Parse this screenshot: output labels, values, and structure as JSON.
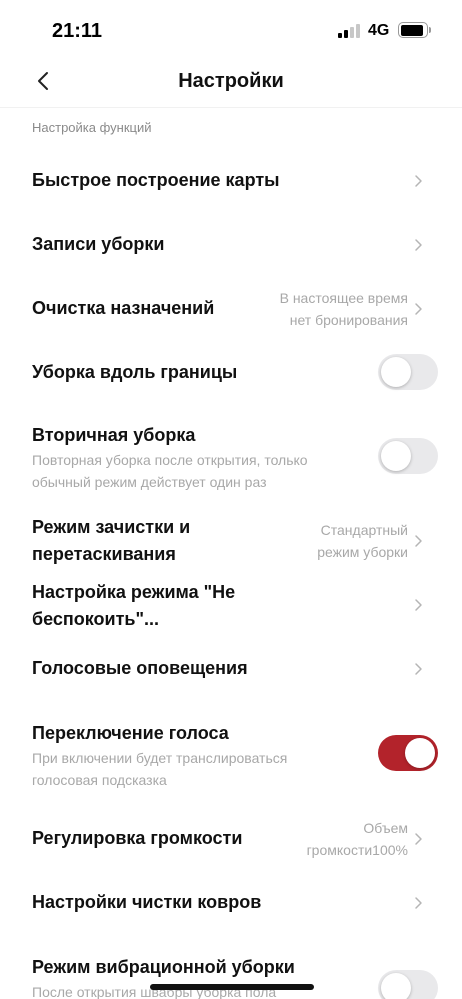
{
  "status_bar": {
    "time": "21:11",
    "network": "4G",
    "battery_level": 0.9
  },
  "header": {
    "title": "Настройки",
    "back_icon": "chevron-left-icon"
  },
  "section_label": "Настройка функций",
  "colors": {
    "accent": "#b3232b",
    "toggle_off": "#e9e9eb",
    "secondary_text": "#a8a8a8"
  },
  "settings": {
    "quick_map": {
      "title": "Быстрое построение карты"
    },
    "cleaning_records": {
      "title": "Записи уборки"
    },
    "clear_schedule": {
      "title": "Очистка назначений",
      "value_line1": "В настоящее время",
      "value_line2": "нет бронирования"
    },
    "edge_cleaning": {
      "title": "Уборка вдоль границы",
      "enabled": false
    },
    "secondary_cleaning": {
      "title": "Вторичная уборка",
      "subtitle_line1": "Повторная уборка после открытия, только",
      "subtitle_line2": "обычный режим действует один раз",
      "enabled": false
    },
    "mop_drag_mode": {
      "title_line1": "Режим зачистки и",
      "title_line2": "перетаскивания",
      "value_line1": "Стандартный",
      "value_line2": "режим уборки"
    },
    "dnd_mode": {
      "title_line1": "Настройка режима \"Не",
      "title_line2": "беспокоить\"..."
    },
    "voice_alerts": {
      "title": "Голосовые оповещения"
    },
    "voice_switch": {
      "title": "Переключение голоса",
      "subtitle_line1": "При включении будет транслироваться",
      "subtitle_line2": "голосовая подсказка",
      "enabled": true
    },
    "volume": {
      "title": "Регулировка громкости",
      "value_line1": "Объем",
      "value_line2": "громкости100%"
    },
    "carpet": {
      "title": "Настройки чистки ковров"
    },
    "vibration": {
      "title": "Режим вибрационной уборки",
      "subtitle_line1": "После открытия швабры уборка пола",
      "enabled": false
    }
  }
}
